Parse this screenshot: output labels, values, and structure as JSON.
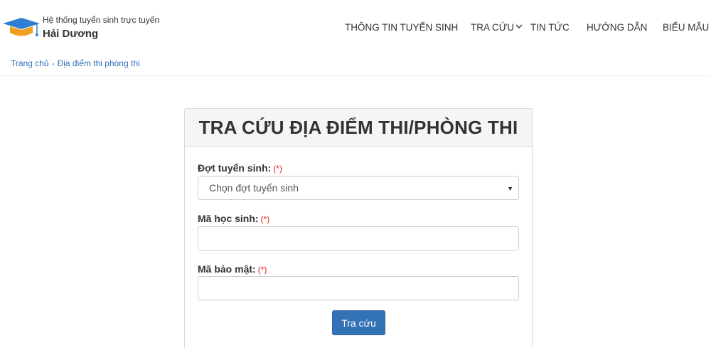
{
  "header": {
    "brand_sub": "Hệ thống tuyển sinh trực tuyến",
    "brand_main": "Hải Dương",
    "logo_icon": "graduation-cap-icon",
    "nav": [
      {
        "label": "THÔNG TIN TUYỂN SINH"
      },
      {
        "label": "TRA CỨU",
        "icon": "chevron-down-icon"
      },
      {
        "label": "TIN TỨC"
      },
      {
        "label": "HƯỚNG DẪN"
      },
      {
        "label": "BIỂU MẪU"
      }
    ]
  },
  "breadcrumb": {
    "home": "Trang chủ",
    "separator": "-",
    "current": "Địa điểm thi phòng thi"
  },
  "form": {
    "title": "TRA CỨU ĐỊA ĐIỂM THI/PHÒNG THI",
    "required_mark": "(*)",
    "round_label": "Đợt tuyển sinh:",
    "round_value": "Chọn đợt tuyển sinh",
    "round_arrow": "▼",
    "student_id_label": "Mã học sinh:",
    "student_id_value": "",
    "security_code_label": "Mã bảo mật:",
    "security_code_value": "",
    "submit_label": "Tra cứu"
  },
  "colors": {
    "accent": "#3372b5",
    "logo_blue": "#2f7fd0",
    "logo_orange": "#f0a020",
    "link": "#2f6fb5",
    "required": "#e02020"
  }
}
